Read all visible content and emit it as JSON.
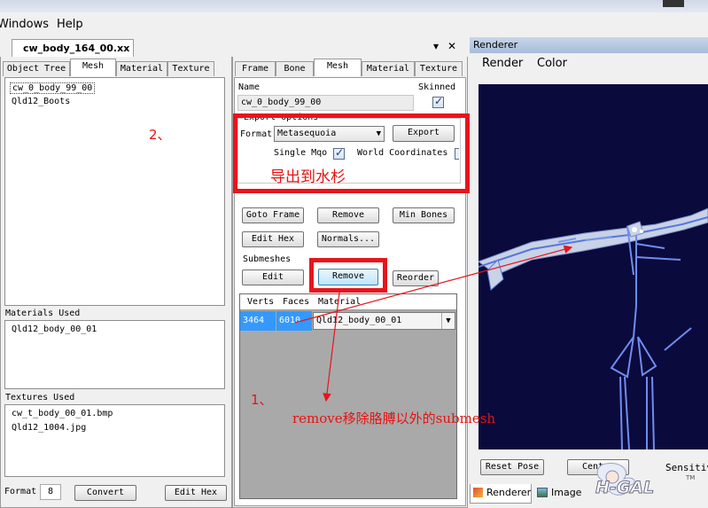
{
  "menu": {
    "items": [
      "Windows",
      "Help"
    ]
  },
  "doc": {
    "title": "cw_body_164_00.xx",
    "pin": "▾",
    "close": "✕"
  },
  "left": {
    "tabs": [
      "Object Tree",
      "Mesh",
      "Material",
      "Texture"
    ],
    "mesh_list": [
      "cw_0_body_99_00",
      "Qld12_Boots"
    ],
    "materials_label": "Materials Used",
    "materials": [
      "Qld12_body_00_01"
    ],
    "textures_label": "Textures Used",
    "textures": [
      "cw_t_body_00_01.bmp",
      "Qld12_1004.jpg"
    ],
    "format_label": "Format",
    "format_value": "8",
    "convert_label": "Convert",
    "edit_hex_label": "Edit Hex"
  },
  "mid": {
    "tabs": [
      "Frame",
      "Bone",
      "Mesh",
      "Material",
      "Texture"
    ],
    "name_label": "Name",
    "name_value": "cw_0_body_99_00",
    "skinned_label": "Skinned",
    "export_group": "Export Options",
    "format_label": "Format",
    "format_value": "Metasequoia",
    "export_label": "Export",
    "single_mqo_label": "Single Mqo",
    "world_coords_label": "World Coordinates",
    "goto_frame": "Goto Frame",
    "remove": "Remove",
    "min_bones": "Min Bones",
    "edit_hex": "Edit Hex",
    "normals": "Normals...",
    "submeshes_label": "Submeshes",
    "edit": "Edit",
    "sub_remove": "Remove",
    "reorder": "Reorder",
    "grid_headers": [
      "Verts",
      "Faces",
      "Material"
    ],
    "grid_row": {
      "verts": "3464",
      "faces": "6010",
      "material": "Qld12_body_00_01"
    }
  },
  "renderer": {
    "title": "Renderer",
    "menu": [
      "Render",
      "Color"
    ],
    "reset_pose": "Reset Pose",
    "center": "Center",
    "sensitivity": "Sensitiv",
    "tabs": [
      "Renderer",
      "Image"
    ],
    "watermark": "H-GAL",
    "tm": "TM"
  },
  "annotations": {
    "step2": "2、",
    "export_note": "导出到水杉",
    "step1": "1、",
    "remove_note": "remove移除胳膊以外的submesh"
  },
  "colors": {
    "annotation_red": "#e8141c",
    "viewport_bg": "#0a0a3c",
    "selection_blue": "#3399ff"
  }
}
